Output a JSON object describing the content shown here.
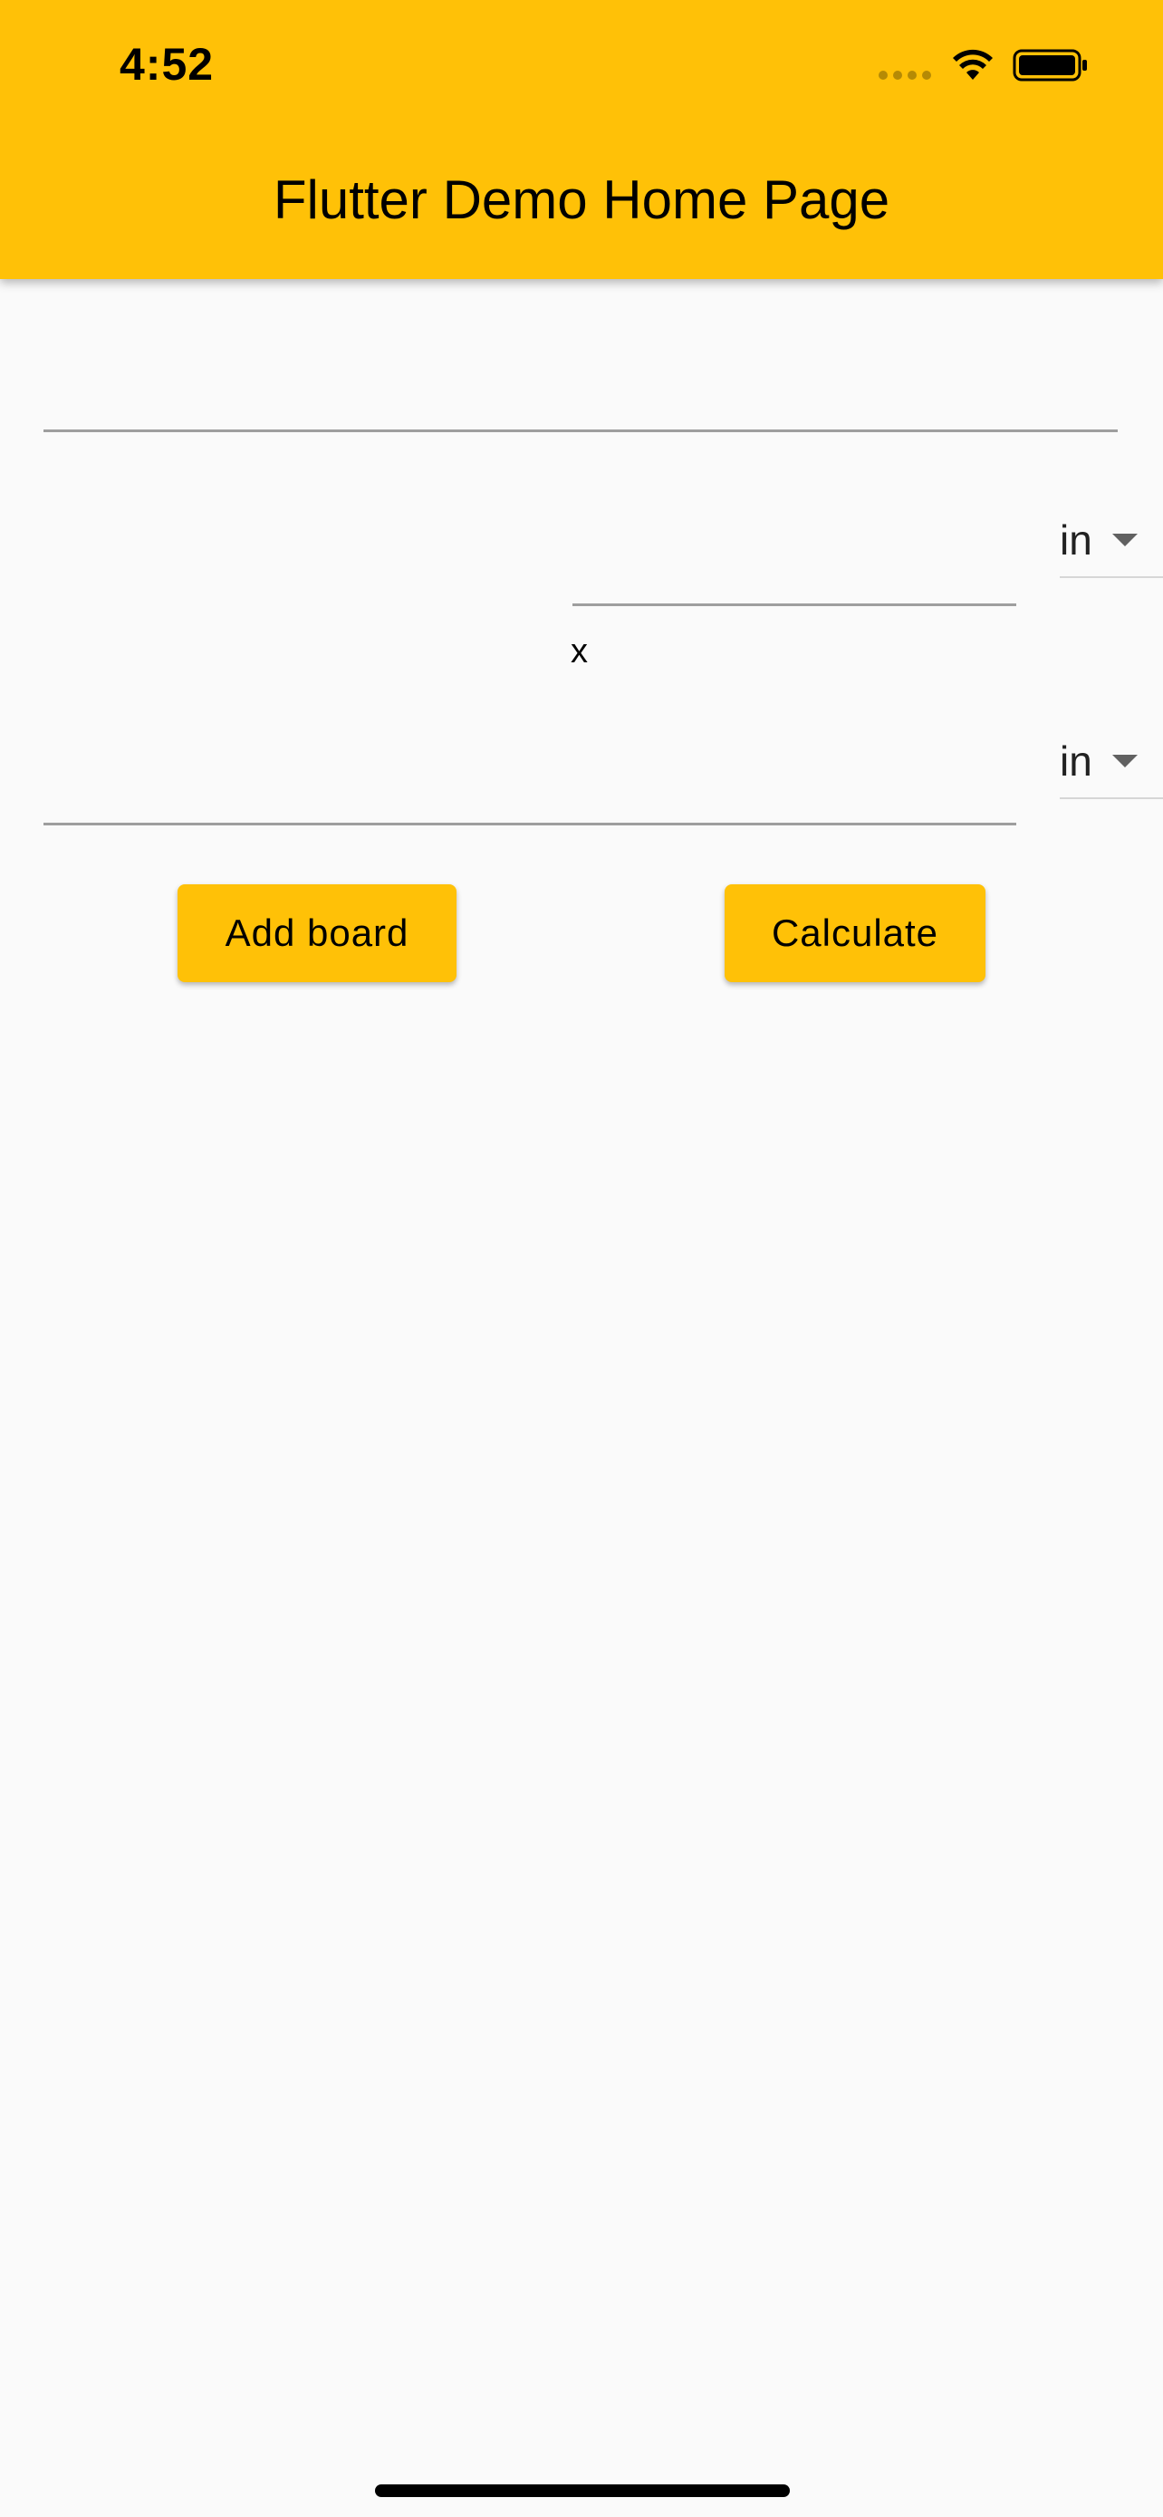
{
  "status_bar": {
    "time": "4:52"
  },
  "app_bar": {
    "title": "Flutter Demo Home Page",
    "background_color": "#ffc107"
  },
  "form": {
    "board_name": {
      "value": "",
      "placeholder": ""
    },
    "width_input": {
      "value": "",
      "placeholder": ""
    },
    "width_unit": {
      "selected": "in"
    },
    "times_label": "x",
    "length_input": {
      "value": "",
      "placeholder": ""
    },
    "length_unit": {
      "selected": "in"
    }
  },
  "actions": {
    "add_board_label": "Add board",
    "calculate_label": "Calculate"
  },
  "icons": {
    "wifi": "wifi-icon",
    "battery": "battery-icon",
    "cellular": "cellular-signal-icon",
    "dropdown": "dropdown-arrow-icon"
  }
}
